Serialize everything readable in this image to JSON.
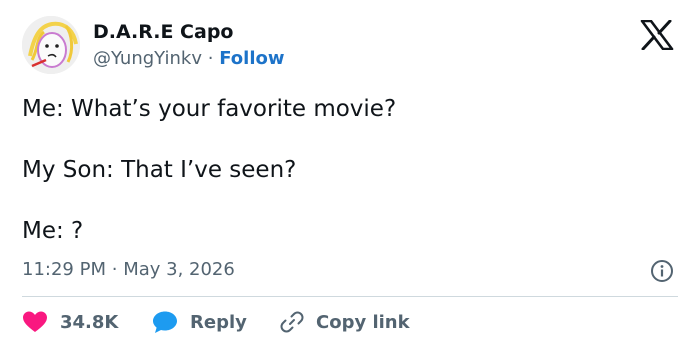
{
  "author": {
    "display_name": "D.A.R.E Capo",
    "handle": "@YungYinkv",
    "separator": "·",
    "follow_label": "Follow"
  },
  "tweet": {
    "lines": [
      "Me: What’s your favorite movie?",
      "My Son: That I’ve seen?",
      "Me: ?"
    ],
    "time": "11:29 PM",
    "date": "May 3, 2026",
    "meta_separator": "·"
  },
  "actions": {
    "likes_count": "34.8K",
    "reply_label": "Reply",
    "copy_link_label": "Copy link"
  },
  "icons": {
    "platform": "x-logo-icon",
    "info": "info-icon",
    "like": "heart-icon",
    "reply": "reply-bubble-icon",
    "copy": "link-icon"
  },
  "colors": {
    "heart": "#f91880",
    "reply_bubble": "#1d9bf0",
    "follow": "#1d73c9",
    "muted": "#536471",
    "text": "#0f1419"
  }
}
